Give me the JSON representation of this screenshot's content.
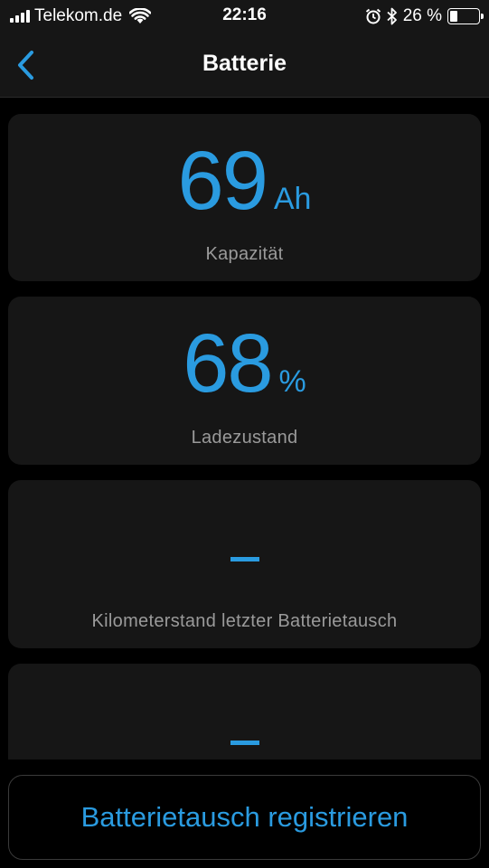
{
  "status_bar": {
    "carrier": "Telekom.de",
    "time": "22:16",
    "battery_percent": "26 %",
    "icons": [
      "signal-icon",
      "wifi-icon",
      "alarm-icon",
      "bluetooth-icon",
      "battery-icon"
    ]
  },
  "nav": {
    "title": "Batterie",
    "back_icon": "chevron-left-icon"
  },
  "cards": [
    {
      "value": "69",
      "unit": "Ah",
      "label": "Kapazität"
    },
    {
      "value": "68",
      "unit": "%",
      "label": "Ladezustand"
    },
    {
      "value": "–",
      "label": "Kilometerstand letzter Batterietausch"
    },
    {
      "value": "–"
    }
  ],
  "actions": {
    "register_label": "Batterietausch registrieren"
  },
  "colors": {
    "accent": "#2a9be0",
    "card_bg": "#161616",
    "label": "#9a9a9a"
  }
}
